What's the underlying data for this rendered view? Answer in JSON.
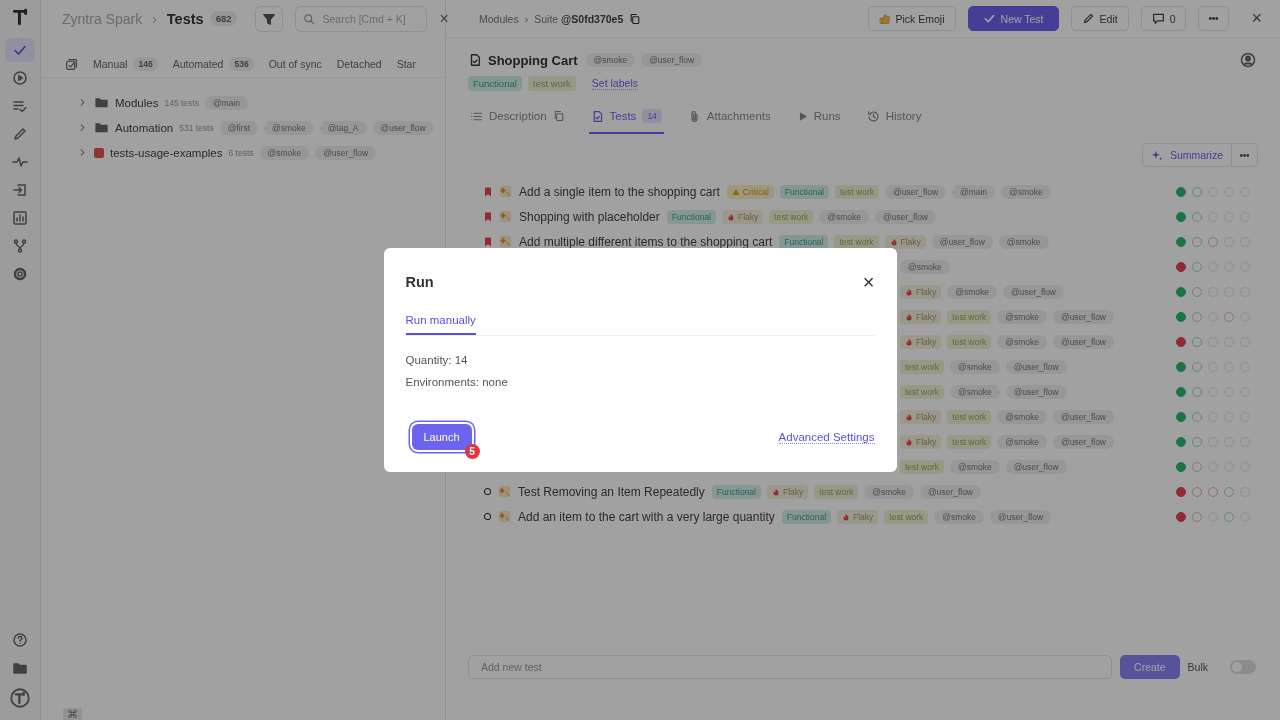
{
  "rail": {
    "items": [
      {
        "kind": "check",
        "selected": true
      },
      {
        "kind": "play",
        "selected": false
      },
      {
        "kind": "list",
        "selected": false
      },
      {
        "kind": "pen",
        "selected": false
      },
      {
        "kind": "pulse",
        "selected": false
      },
      {
        "kind": "import",
        "selected": false
      },
      {
        "kind": "chart",
        "selected": false
      },
      {
        "kind": "branch",
        "selected": false
      },
      {
        "kind": "gear",
        "selected": false
      }
    ],
    "bottom": [
      {
        "kind": "help"
      },
      {
        "kind": "folder"
      },
      {
        "kind": "logo"
      }
    ],
    "shortcut": "⌘"
  },
  "left": {
    "workspace": "Zyntra Spark",
    "separator": "›",
    "title": "Tests",
    "count": "682",
    "search": {
      "placeholder": "Search [Cmd + K]"
    },
    "close": "×",
    "filters": [
      {
        "label": "Manual",
        "count": "146"
      },
      {
        "label": "Automated",
        "count": "536"
      },
      {
        "label": "Out of sync"
      },
      {
        "label": "Detached"
      },
      {
        "label": "Star"
      }
    ],
    "tree": [
      {
        "kind": "folder",
        "name": "Modules",
        "count": "145 tests",
        "tags": [
          "@main"
        ]
      },
      {
        "kind": "folder",
        "name": "Automation",
        "count": "531 tests",
        "tags": [
          "@first",
          "@smoke",
          "@tag_A",
          "@user_flow"
        ]
      },
      {
        "kind": "suite",
        "name": "tests-usage-examples",
        "count": "6 tests",
        "tags": [
          "@smoke",
          "@user_flow"
        ]
      }
    ]
  },
  "right": {
    "breadcrumb": [
      "Modules",
      "Suite **@S0fd370e5**"
    ],
    "breadcrumb_separator": "›",
    "actions": {
      "emoji": "Pick Emoji",
      "new_test": "New Test",
      "edit": "Edit",
      "comments": "0",
      "close": "×"
    },
    "suite": {
      "title": "Shopping Cart",
      "tags": [
        "@smoke",
        "@user_flow"
      ],
      "labels": [
        {
          "text": "Functional",
          "kind": "functional"
        },
        {
          "text": "test work",
          "kind": "work"
        }
      ],
      "set_labels": "Set labels"
    },
    "tabs": [
      {
        "label": "Description",
        "kind": "description",
        "selected": false
      },
      {
        "label": "Tests",
        "kind": "tests",
        "count": "14",
        "selected": true
      },
      {
        "label": "Attachments",
        "kind": "attachments",
        "selected": false
      },
      {
        "label": "Runs",
        "kind": "runs",
        "selected": false
      },
      {
        "label": "History",
        "kind": "history",
        "selected": false
      }
    ],
    "summarize": "Summarize",
    "tests": [
      {
        "kind": "full",
        "bookmarked": true,
        "title": "Add a single item to the shopping cart",
        "tags": [
          {
            "text": "Critical",
            "kind": "critical"
          },
          {
            "text": "Functional",
            "kind": "functional"
          },
          {
            "text": "test work",
            "kind": "work"
          },
          {
            "text": "@user_flow",
            "kind": "tag"
          },
          {
            "text": "@main",
            "kind": "tag"
          },
          {
            "text": "@smoke",
            "kind": "tag"
          }
        ],
        "results": [
          {
            "ran": true,
            "passed": true,
            "filled": true
          },
          {
            "ran": true,
            "passed": true,
            "filled": false
          },
          {
            "ran": false
          },
          {
            "ran": false
          },
          {
            "ran": false
          }
        ]
      },
      {
        "kind": "full",
        "bookmarked": true,
        "title": "Shopping with placeholder",
        "tags": [
          {
            "text": "Functional",
            "kind": "functional"
          },
          {
            "text": "Flaky",
            "kind": "flaky"
          },
          {
            "text": "test work",
            "kind": "work"
          },
          {
            "text": "@smoke",
            "kind": "tag"
          },
          {
            "text": "@user_flow",
            "kind": "tag"
          }
        ],
        "results": [
          {
            "ran": true,
            "passed": true,
            "filled": true
          },
          {
            "ran": true,
            "passed": true,
            "filled": false
          },
          {
            "ran": false
          },
          {
            "ran": false
          },
          {
            "ran": false
          }
        ]
      },
      {
        "kind": "full",
        "bookmarked": true,
        "title": "Add multiple different items to the shopping cart",
        "tags": [
          {
            "text": "Functional",
            "kind": "functional"
          },
          {
            "text": "test work",
            "kind": "work"
          },
          {
            "text": "Flaky",
            "kind": "flaky"
          },
          {
            "text": "@user_flow",
            "kind": "tag"
          },
          {
            "text": "@smoke",
            "kind": "tag"
          }
        ],
        "results": [
          {
            "ran": true,
            "passed": true,
            "filled": true
          },
          {
            "ran": true,
            "passed": true,
            "filled": false
          },
          {
            "ran": true,
            "passed": false,
            "filled": false
          },
          {
            "ran": false
          },
          {
            "ran": false
          }
        ]
      },
      {
        "kind": "covered",
        "tags": [
          {
            "text": "@smoke",
            "kind": "tag"
          }
        ],
        "results": [
          {
            "ran": true,
            "passed": false,
            "filled": true
          },
          {
            "ran": true,
            "passed": true,
            "filled": false
          },
          {
            "ran": false
          },
          {
            "ran": false
          },
          {
            "ran": false
          }
        ]
      },
      {
        "kind": "covered",
        "tags": [
          {
            "text": "Flaky",
            "kind": "flaky"
          },
          {
            "text": "@smoke",
            "kind": "tag"
          },
          {
            "text": "@user_flow",
            "kind": "tag"
          }
        ],
        "results": [
          {
            "ran": true,
            "passed": true,
            "filled": true
          },
          {
            "ran": true,
            "passed": true,
            "filled": false
          },
          {
            "ran": false
          },
          {
            "ran": false
          },
          {
            "ran": false
          }
        ]
      },
      {
        "kind": "covered",
        "tags": [
          {
            "text": "Flaky",
            "kind": "flaky"
          },
          {
            "text": "test work",
            "kind": "work"
          },
          {
            "text": "@smoke",
            "kind": "tag"
          },
          {
            "text": "@user_flow",
            "kind": "tag"
          }
        ],
        "results": [
          {
            "ran": true,
            "passed": true,
            "filled": true
          },
          {
            "ran": true,
            "passed": true,
            "filled": false
          },
          {
            "ran": false
          },
          {
            "ran": true,
            "passed": false,
            "filled": false
          },
          {
            "ran": false
          }
        ]
      },
      {
        "kind": "covered",
        "tags": [
          {
            "text": "Flaky",
            "kind": "flaky"
          },
          {
            "text": "test work",
            "kind": "work"
          },
          {
            "text": "@smoke",
            "kind": "tag"
          },
          {
            "text": "@user_flow",
            "kind": "tag"
          }
        ],
        "results": [
          {
            "ran": true,
            "passed": false,
            "filled": true
          },
          {
            "ran": true,
            "passed": true,
            "filled": false
          },
          {
            "ran": false
          },
          {
            "ran": false
          },
          {
            "ran": false
          }
        ]
      },
      {
        "kind": "covered",
        "tags": [
          {
            "text": "test work",
            "kind": "work"
          },
          {
            "text": "@smoke",
            "kind": "tag"
          },
          {
            "text": "@user_flow",
            "kind": "tag"
          }
        ],
        "results": [
          {
            "ran": true,
            "passed": true,
            "filled": true
          },
          {
            "ran": true,
            "passed": true,
            "filled": false
          },
          {
            "ran": false
          },
          {
            "ran": false
          },
          {
            "ran": false
          }
        ]
      },
      {
        "kind": "covered",
        "tags": [
          {
            "text": "test work",
            "kind": "work"
          },
          {
            "text": "@smoke",
            "kind": "tag"
          },
          {
            "text": "@user_flow",
            "kind": "tag"
          }
        ],
        "results": [
          {
            "ran": true,
            "passed": true,
            "filled": true
          },
          {
            "ran": true,
            "passed": true,
            "filled": false
          },
          {
            "ran": false
          },
          {
            "ran": false
          },
          {
            "ran": false
          }
        ]
      },
      {
        "kind": "covered",
        "tags": [
          {
            "text": "Flaky",
            "kind": "flaky"
          },
          {
            "text": "test work",
            "kind": "work"
          },
          {
            "text": "@smoke",
            "kind": "tag"
          },
          {
            "text": "@user_flow",
            "kind": "tag"
          }
        ],
        "results": [
          {
            "ran": true,
            "passed": true,
            "filled": true
          },
          {
            "ran": true,
            "passed": true,
            "filled": false
          },
          {
            "ran": false
          },
          {
            "ran": false
          },
          {
            "ran": false
          }
        ]
      },
      {
        "kind": "covered",
        "tags": [
          {
            "text": "Flaky",
            "kind": "flaky"
          },
          {
            "text": "test work",
            "kind": "work"
          },
          {
            "text": "@smoke",
            "kind": "tag"
          },
          {
            "text": "@user_flow",
            "kind": "tag"
          }
        ],
        "results": [
          {
            "ran": true,
            "passed": true,
            "filled": true
          },
          {
            "ran": true,
            "passed": true,
            "filled": false
          },
          {
            "ran": false
          },
          {
            "ran": false
          },
          {
            "ran": false
          }
        ]
      },
      {
        "kind": "covered",
        "tags": [
          {
            "text": "test work",
            "kind": "work"
          },
          {
            "text": "@smoke",
            "kind": "tag"
          },
          {
            "text": "@user_flow",
            "kind": "tag"
          }
        ],
        "results": [
          {
            "ran": true,
            "passed": true,
            "filled": true
          },
          {
            "ran": true,
            "passed": true,
            "filled": false
          },
          {
            "ran": false
          },
          {
            "ran": false
          },
          {
            "ran": false
          }
        ]
      },
      {
        "kind": "full",
        "bookmarked": false,
        "title": "Test Removing an Item Repeatedly",
        "tags": [
          {
            "text": "Functional",
            "kind": "functional"
          },
          {
            "text": "Flaky",
            "kind": "flaky"
          },
          {
            "text": "test work",
            "kind": "work"
          },
          {
            "text": "@smoke",
            "kind": "tag"
          },
          {
            "text": "@user_flow",
            "kind": "tag"
          }
        ],
        "results": [
          {
            "ran": true,
            "passed": false,
            "filled": true
          },
          {
            "ran": true,
            "passed": false,
            "filled": false
          },
          {
            "ran": true,
            "passed": false,
            "filled": false
          },
          {
            "ran": true,
            "passed": true,
            "filled": false
          },
          {
            "ran": false
          }
        ]
      },
      {
        "kind": "full",
        "bookmarked": false,
        "title": "Add an item to the cart with a very large quantity",
        "tags": [
          {
            "text": "Functional",
            "kind": "functional"
          },
          {
            "text": "Flaky",
            "kind": "flaky"
          },
          {
            "text": "test work",
            "kind": "work"
          },
          {
            "text": "@smoke",
            "kind": "tag"
          },
          {
            "text": "@user_flow",
            "kind": "tag"
          }
        ],
        "results": [
          {
            "ran": true,
            "passed": false,
            "filled": true
          },
          {
            "ran": true,
            "passed": false,
            "filled": false
          },
          {
            "ran": false
          },
          {
            "ran": true,
            "passed": true,
            "filled": false
          },
          {
            "ran": false
          }
        ]
      }
    ],
    "new_test": {
      "placeholder": "Add new test",
      "create": "Create",
      "bulk": "Bulk",
      "bulk_on": false
    }
  },
  "modal": {
    "title": "Run",
    "close": "×",
    "tabs": [
      {
        "label": "Run manually",
        "selected": true
      }
    ],
    "lines": [
      "Quantity: 14",
      "Environments: none"
    ],
    "launch": "Launch",
    "badge": "5",
    "advanced": "Advanced Settings"
  }
}
